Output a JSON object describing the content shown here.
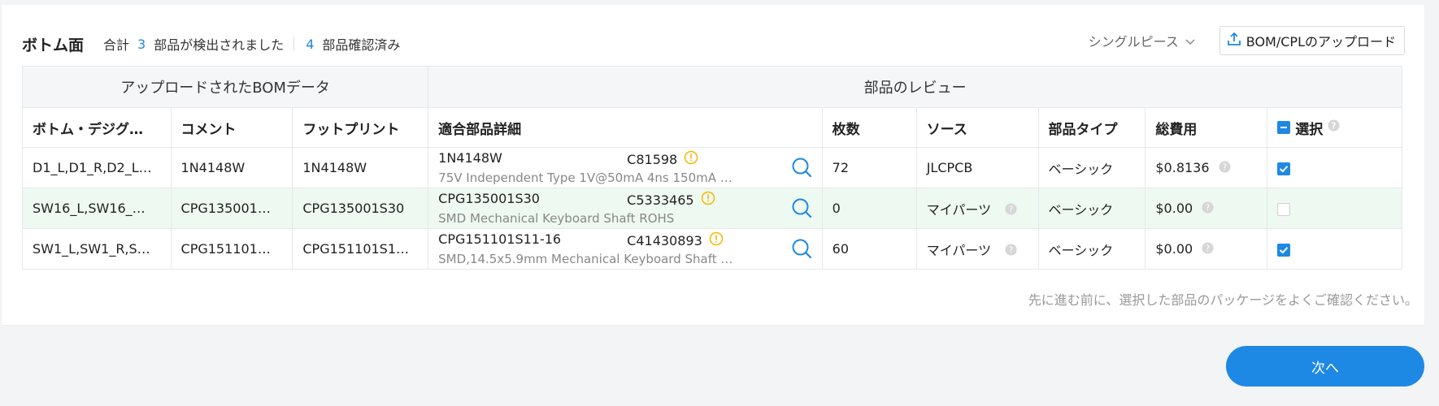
{
  "header": {
    "title": "ボトム面",
    "summary_prefix": "合計",
    "detected_count": "3",
    "detected_label": "部品が検出されました",
    "confirmed_count": "4",
    "confirmed_label": "部品確認済み",
    "mode_select": "シングルピース",
    "upload_label": "BOM/CPLのアップロード"
  },
  "table": {
    "group_left": "アップロードされたBOMデータ",
    "group_right": "部品のレビュー",
    "columns": [
      "ボトム・デジグ…",
      "コメント",
      "フットプリント",
      "適合部品詳細",
      "枚数",
      "ソース",
      "部品タイプ",
      "総費用",
      "選択"
    ],
    "rows": [
      {
        "designator": "D1_L,D1_R,D2_L…",
        "comment": "1N4148W",
        "footprint": "1N4148W",
        "part_name": "1N4148W",
        "part_code": "C81598",
        "part_desc": "75V Independent Type 1V@50mA 4ns 150mA …",
        "qty": "72",
        "source": "JLCPCB",
        "part_type": "ベーシック",
        "total_cost": "$0.8136",
        "selected": true
      },
      {
        "designator": "SW16_L,SW16_…",
        "comment": "CPG135001…",
        "footprint": "CPG135001S30",
        "part_name": "CPG135001S30",
        "part_code": "C5333465",
        "part_desc": "SMD Mechanical Keyboard Shaft ROHS",
        "qty": "0",
        "source": "マイパーツ",
        "part_type": "ベーシック",
        "total_cost": "$0.00",
        "selected": false
      },
      {
        "designator": "SW1_L,SW1_R,S…",
        "comment": "CPG151101…",
        "footprint": "CPG151101S1…",
        "part_name": "CPG151101S11-16",
        "part_code": "C41430893",
        "part_desc": "SMD,14.5x5.9mm Mechanical Keyboard Shaft …",
        "qty": "60",
        "source": "マイパーツ",
        "part_type": "ベーシック",
        "total_cost": "$0.00",
        "selected": true
      }
    ]
  },
  "note": "先に進む前に、選択した部品のパッケージをよくご確認ください。",
  "next_label": "次へ",
  "colors": {
    "accent": "#1e88e5",
    "highlight_row": "#edf9f1",
    "warning": "#f5b800"
  }
}
